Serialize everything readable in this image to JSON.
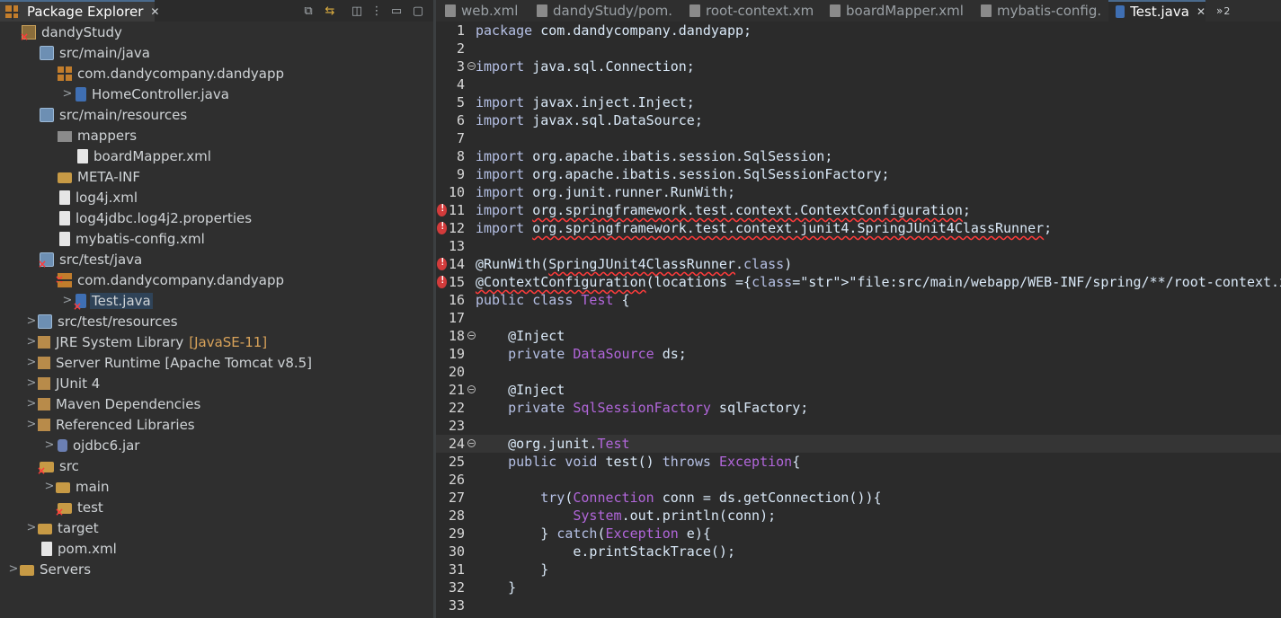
{
  "explorer": {
    "title": "Package Explorer",
    "tree": [
      {
        "label": "dandyStudy",
        "icon": "project-icon",
        "caret": ""
      },
      {
        "label": "src/main/java",
        "icon": "source-folder-icon",
        "caret": ""
      },
      {
        "label": "com.dandycompany.dandyapp",
        "icon": "package-icon",
        "caret": ""
      },
      {
        "label": "HomeController.java",
        "icon": "java-file-icon",
        "caret": ">"
      },
      {
        "label": "src/main/resources",
        "icon": "source-folder-icon",
        "caret": ""
      },
      {
        "label": "mappers",
        "icon": "package-icon",
        "caret": ""
      },
      {
        "label": "boardMapper.xml",
        "icon": "xml-file-icon",
        "caret": ""
      },
      {
        "label": "META-INF",
        "icon": "folder-icon",
        "caret": ""
      },
      {
        "label": "log4j.xml",
        "icon": "xml-file-icon",
        "caret": ""
      },
      {
        "label": "log4jdbc.log4j2.properties",
        "icon": "text-file-icon",
        "caret": ""
      },
      {
        "label": "mybatis-config.xml",
        "icon": "xml-file-icon",
        "caret": ""
      },
      {
        "label": "src/test/java",
        "icon": "source-folder-icon",
        "caret": ""
      },
      {
        "label": "com.dandycompany.dandyapp",
        "icon": "package-icon",
        "caret": ""
      },
      {
        "label": "Test.java",
        "icon": "java-file-icon",
        "caret": ">"
      },
      {
        "label": "src/test/resources",
        "icon": "source-folder-icon",
        "caret": ">"
      },
      {
        "label": "JRE System Library",
        "deco": "[JavaSE-11]",
        "icon": "library-icon",
        "caret": ">"
      },
      {
        "label": "Server Runtime [Apache Tomcat v8.5]",
        "icon": "library-icon",
        "caret": ">"
      },
      {
        "label": "JUnit 4",
        "icon": "library-icon",
        "caret": ">"
      },
      {
        "label": "Maven Dependencies",
        "icon": "library-icon",
        "caret": ">"
      },
      {
        "label": "Referenced Libraries",
        "icon": "library-icon",
        "caret": ">"
      },
      {
        "label": "ojdbc6.jar",
        "icon": "jar-icon",
        "caret": ">"
      },
      {
        "label": "src",
        "icon": "folder-icon",
        "caret": ""
      },
      {
        "label": "main",
        "icon": "folder-icon",
        "caret": ">"
      },
      {
        "label": "test",
        "icon": "folder-icon",
        "caret": ""
      },
      {
        "label": "target",
        "icon": "folder-icon",
        "caret": ">"
      },
      {
        "label": "pom.xml",
        "icon": "pom-file-icon",
        "caret": ""
      },
      {
        "label": "Servers",
        "icon": "folder-icon",
        "caret": ">"
      }
    ]
  },
  "editor": {
    "tabs": [
      {
        "label": "web.xml"
      },
      {
        "label": "dandyStudy/pom."
      },
      {
        "label": "root-context.xm"
      },
      {
        "label": "boardMapper.xml"
      },
      {
        "label": "mybatis-config."
      },
      {
        "label": "Test.java"
      }
    ],
    "overflow_count": "2",
    "lines": [
      {
        "n": "1",
        "code": "package com.dandycompany.dandyapp;"
      },
      {
        "n": "2",
        "code": ""
      },
      {
        "n": "3",
        "code": "import java.sql.Connection;"
      },
      {
        "n": "4",
        "code": ""
      },
      {
        "n": "5",
        "code": "import javax.inject.Inject;"
      },
      {
        "n": "6",
        "code": "import javax.sql.DataSource;"
      },
      {
        "n": "7",
        "code": ""
      },
      {
        "n": "8",
        "code": "import org.apache.ibatis.session.SqlSession;"
      },
      {
        "n": "9",
        "code": "import org.apache.ibatis.session.SqlSessionFactory;"
      },
      {
        "n": "10",
        "code": "import org.junit.runner.RunWith;"
      },
      {
        "n": "11",
        "code": "import org.springframework.test.context.ContextConfiguration;"
      },
      {
        "n": "12",
        "code": "import org.springframework.test.context.junit4.SpringJUnit4ClassRunner;"
      },
      {
        "n": "13",
        "code": ""
      },
      {
        "n": "14",
        "code": "@RunWith(SpringJUnit4ClassRunner.class)"
      },
      {
        "n": "15",
        "code": "@ContextConfiguration(locations ={\"file:src/main/webapp/WEB-INF/spring/**/root-context.xml\"})"
      },
      {
        "n": "16",
        "code": "public class Test {"
      },
      {
        "n": "17",
        "code": ""
      },
      {
        "n": "18",
        "code": "    @Inject"
      },
      {
        "n": "19",
        "code": "    private DataSource ds;"
      },
      {
        "n": "20",
        "code": ""
      },
      {
        "n": "21",
        "code": "    @Inject"
      },
      {
        "n": "22",
        "code": "    private SqlSessionFactory sqlFactory;"
      },
      {
        "n": "23",
        "code": ""
      },
      {
        "n": "24",
        "code": "    @org.junit.Test"
      },
      {
        "n": "25",
        "code": "    public void test() throws Exception{"
      },
      {
        "n": "26",
        "code": ""
      },
      {
        "n": "27",
        "code": "        try(Connection conn = ds.getConnection()){"
      },
      {
        "n": "28",
        "code": "            System.out.println(conn);"
      },
      {
        "n": "29",
        "code": "        } catch(Exception e){"
      },
      {
        "n": "30",
        "code": "            e.printStackTrace();"
      },
      {
        "n": "31",
        "code": "        }"
      },
      {
        "n": "32",
        "code": "    }"
      },
      {
        "n": "33",
        "code": ""
      }
    ]
  }
}
